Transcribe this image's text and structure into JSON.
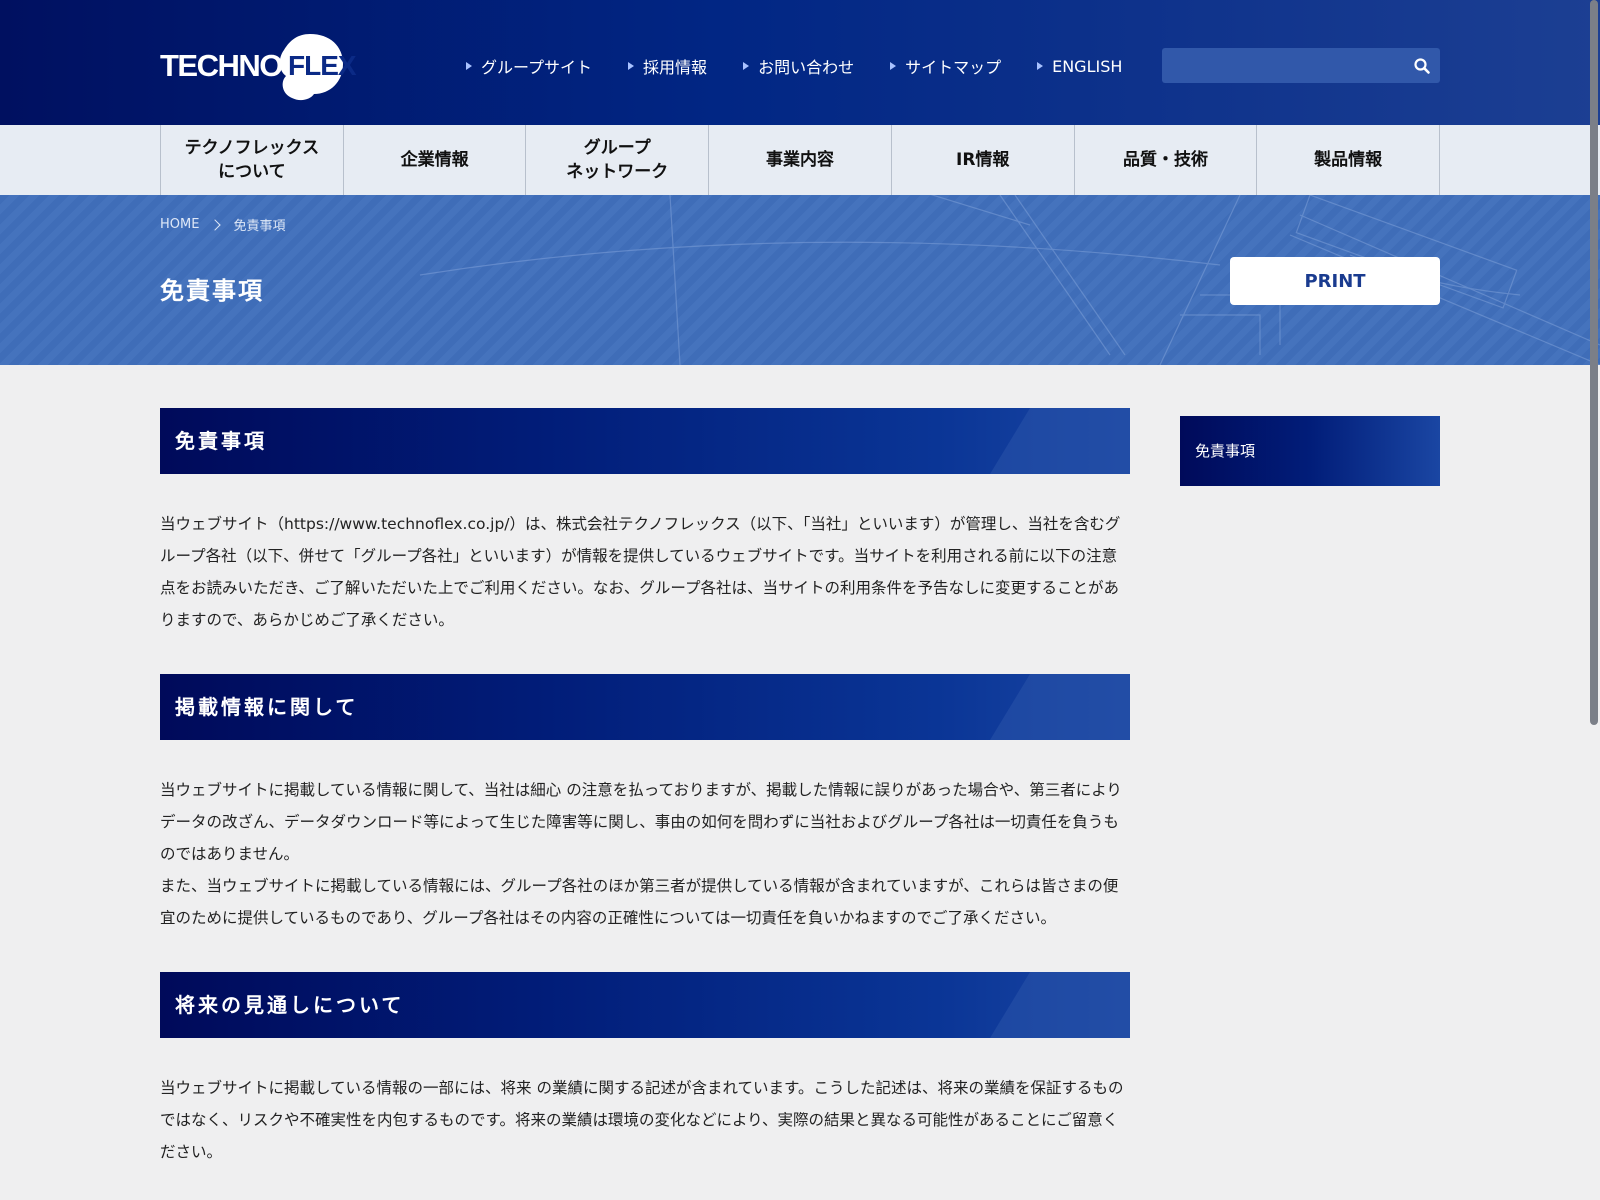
{
  "brand": {
    "logo_text": "TECHNO",
    "logo_text_2": "FLEX"
  },
  "utility_nav": [
    {
      "label": "グループサイト"
    },
    {
      "label": "採用情報"
    },
    {
      "label": "お問い合わせ"
    },
    {
      "label": "サイトマップ"
    },
    {
      "label": "ENGLISH"
    }
  ],
  "search": {
    "placeholder": ""
  },
  "global_nav": [
    {
      "label": "テクノフレックス\nについて"
    },
    {
      "label": "企業情報"
    },
    {
      "label": "グループ\nネットワーク"
    },
    {
      "label": "事業内容"
    },
    {
      "label": "IR情報"
    },
    {
      "label": "品質・技術"
    },
    {
      "label": "製品情報"
    }
  ],
  "breadcrumb": {
    "home": "HOME",
    "current": "免責事項"
  },
  "page": {
    "title": "免責事項",
    "print_label": "PRINT"
  },
  "sections": [
    {
      "heading": "免責事項",
      "paragraphs": [
        "当ウェブサイト（https://www.technoflex.co.jp/）は、株式会社テクノフレックス（以下、「当社」といいます）が管理し、当社を含むグループ各社（以下、併せて「グループ各社」といいます）が情報を提供しているウェブサイトです。当サイトを利用される前に以下の注意点をお読みいただき、ご了解いただいた上でご利用ください。なお、グループ各社は、当サイトの利用条件を予告なしに変更することがありますので、あらかじめご了承ください。"
      ]
    },
    {
      "heading": "掲載情報に関して",
      "paragraphs": [
        "当ウェブサイトに掲載している情報に関して、当社は細心 の注意を払っておりますが、掲載した情報に誤りがあった場合や、第三者によりデータの改ざん、データダウンロード等によって生じた障害等に関し、事由の如何を問わずに当社およびグループ各社は一切責任を負うものではありません。",
        "また、当ウェブサイトに掲載している情報には、グループ各社のほか第三者が提供している情報が含まれていますが、これらは皆さまの便宜のために提供しているものであり、グループ各社はその内容の正確性については一切責任を負いかねますのでご了承ください。"
      ]
    },
    {
      "heading": "将来の見通しについて",
      "paragraphs": [
        "当ウェブサイトに掲載している情報の一部には、将来 の業績に関する記述が含まれています。こうした記述は、将来の業績を保証するものではなく、リスクや不確実性を内包するものです。将来の業績は環境の変化などにより、実際の結果と異なる可能性があることにご留意ください。"
      ]
    }
  ],
  "side_nav": {
    "items": [
      {
        "label": "免責事項"
      }
    ]
  },
  "colors": {
    "header_dark": "#001060",
    "header_light": "#1c3f93",
    "hero": "#4270ba",
    "nav_bg": "#e7ecf3",
    "page_bg": "#efeff0",
    "print_text": "#1a3b8f"
  }
}
